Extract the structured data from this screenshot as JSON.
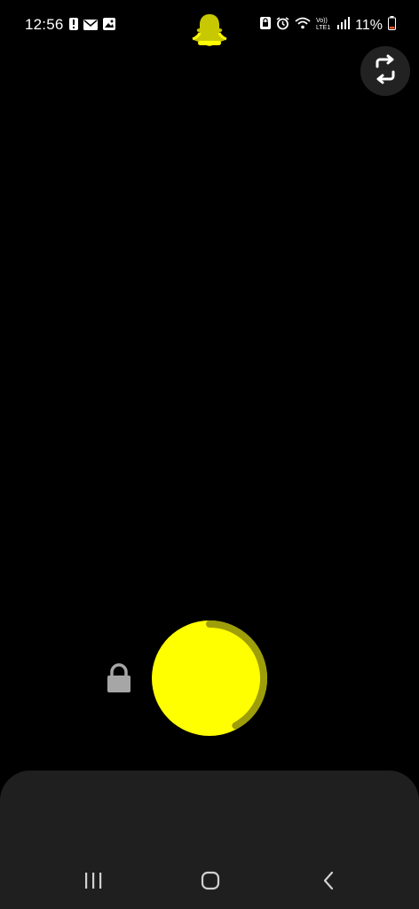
{
  "status_bar": {
    "time": "12:56",
    "battery_percent": "11%",
    "left_icons": [
      "alert-icon",
      "mail-icon",
      "image-icon"
    ],
    "right_icons": [
      "lock-screen-icon",
      "alarm-icon",
      "wifi-icon",
      "volte-icon",
      "signal-icon",
      "battery-icon"
    ]
  },
  "app": {
    "name": "Snapchat",
    "accent_color": "#FFFC00",
    "ring_color": "#9E9E0A"
  },
  "camera": {
    "flip_icon": "flip-camera-icon",
    "capture_icon": "capture-button",
    "lock_icon": "lock-icon",
    "recording_progress": 0.42
  },
  "navigation": {
    "recent": "recent-apps-icon",
    "home": "home-icon",
    "back": "back-icon"
  }
}
